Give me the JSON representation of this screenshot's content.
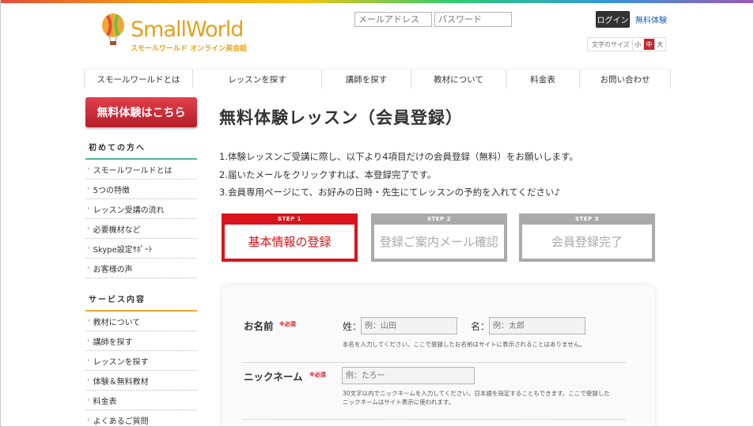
{
  "header": {
    "brand": "SmallWorld",
    "tagline": "スモールワールド オンライン英会話",
    "email_placeholder": "メールアドレス",
    "password_placeholder": "パスワード",
    "login_label": "ログイン",
    "trial_link": "無料体験",
    "font_size_label": "文字のサイズ",
    "font_sizes": [
      "小",
      "中",
      "大"
    ]
  },
  "nav": [
    "スモールワールドとは",
    "レッスンを探す",
    "講師を探す",
    "教材について",
    "料金表",
    "お問い合わせ"
  ],
  "sidebar": {
    "banner": "無料体験はこちら",
    "section1": {
      "title": "初めての方へ",
      "items": [
        "スモールワールドとは",
        "5つの特徴",
        "レッスン受講の流れ",
        "必要機材など",
        "Skype設定ｻﾎﾟｰﾄ",
        "お客様の声"
      ]
    },
    "section2": {
      "title": "サービス内容",
      "items": [
        "教材について",
        "講師を探す",
        "レッスンを探す",
        "体験＆無料教材",
        "料金表",
        "よくあるご質問"
      ]
    }
  },
  "main": {
    "title": "無料体験レッスン（会員登録）",
    "intro": [
      "1.体験レッスンご受講に際し、以下より4項目だけの会員登録（無料）をお願いします。",
      "2.届いたメールをクリックすれば、本登録完了です。",
      "3.会員専用ページにて、お好みの日時・先生にてレッスンの予約を入れてください♪"
    ],
    "steps": [
      {
        "cap": "STEP 1",
        "label": "基本情報の登録"
      },
      {
        "cap": "STEP 2",
        "label": "登録ご案内メール確認"
      },
      {
        "cap": "STEP 3",
        "label": "会員登録完了"
      }
    ],
    "form": {
      "name_label": "お名前",
      "required": "※必須",
      "last_label": "姓：",
      "last_placeholder": "例：山田",
      "first_label": "名：",
      "first_placeholder": "例：太郎",
      "name_note": "本名を入力してください。ここで登録したお名前はサイトに表示されることはありません。",
      "nick_label": "ニックネーム",
      "nick_placeholder": "例：たろー",
      "nick_note_1": "30文字以内でニックネームを入力してください。日本語を指定することもできます。ここで登録した",
      "nick_note_2": "ニックネームはサイト表示に使われます。"
    }
  },
  "colors": {
    "accent_red": "#d9141c",
    "brand_orange": "#e6a118",
    "green_rule": "#4cb89a",
    "orange_rule": "#f0a830",
    "inactive_gray": "#aaaaaa"
  }
}
